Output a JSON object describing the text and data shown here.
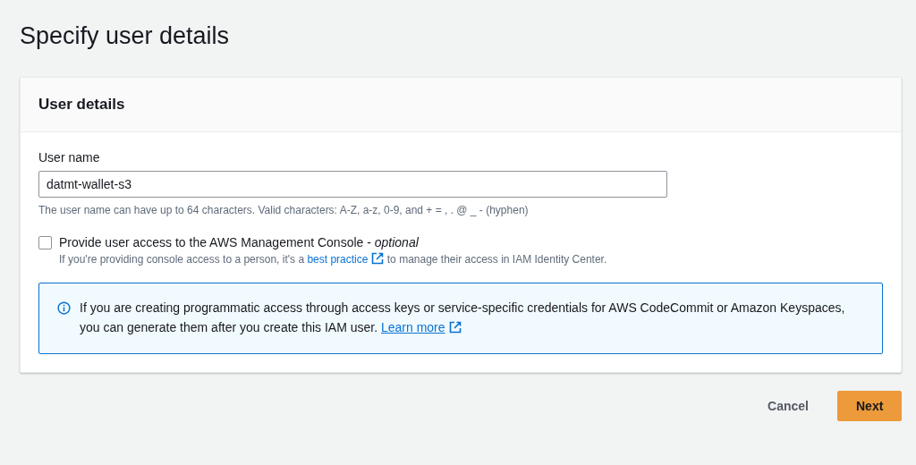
{
  "page_title": "Specify user details",
  "panel": {
    "title": "User details",
    "user_name": {
      "label": "User name",
      "value": "datmt-wallet-s3",
      "hint": "The user name can have up to 64 characters. Valid characters: A-Z, a-z, 0-9, and + = , . @ _ - (hyphen)"
    },
    "console_access": {
      "label": "Provide user access to the AWS Management Console - ",
      "label_optional": "optional",
      "checked": false,
      "description_before": "If you're providing console access to a person, it's a ",
      "description_link": "best practice",
      "description_after": " to manage their access in IAM Identity Center."
    },
    "info": {
      "text": "If you are creating programmatic access through access keys or service-specific credentials for AWS CodeCommit or Amazon Keyspaces, you can generate them after you create this IAM user. ",
      "link": "Learn more"
    }
  },
  "actions": [
    {
      "label": "Cancel",
      "kind": "link"
    },
    {
      "label": "Next",
      "kind": "primary"
    }
  ]
}
